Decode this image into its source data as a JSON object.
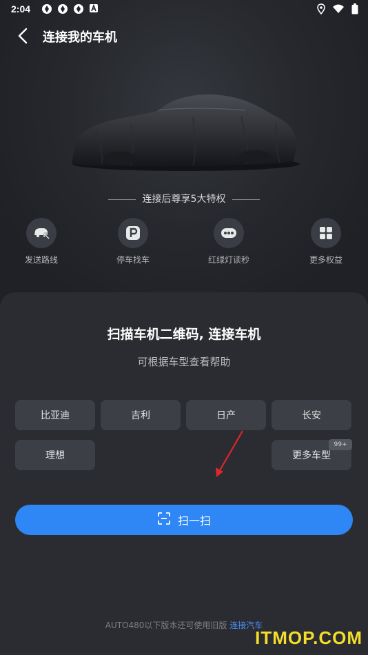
{
  "status_bar": {
    "time": "2:04"
  },
  "header": {
    "title": "连接我的车机"
  },
  "privileges": {
    "title": "连接后尊享5大特权",
    "items": [
      {
        "icon": "car-route-icon",
        "label": "发送路线"
      },
      {
        "icon": "parking-icon",
        "label": "停车找车"
      },
      {
        "icon": "traffic-light-icon",
        "label": "红绿灯读秒"
      },
      {
        "icon": "grid-icon",
        "label": "更多权益"
      }
    ]
  },
  "sheet": {
    "title": "扫描车机二维码, 连接车机",
    "subtitle": "可根据车型查看帮助",
    "brands": [
      "比亚迪",
      "吉利",
      "日产",
      "长安",
      "理想"
    ],
    "more_label": "更多车型",
    "more_badge": "99+",
    "scan_label": "扫一扫",
    "footer_text": "AUTO480以下版本还可使用旧版",
    "footer_link": "连接汽车"
  },
  "watermark": "ITMOP.COM",
  "colors": {
    "accent": "#2f86f5",
    "sheet_bg": "#2a2c31",
    "page_bg": "#1f2126",
    "arrow": "#e0262b",
    "watermark": "#f4dd2b"
  }
}
